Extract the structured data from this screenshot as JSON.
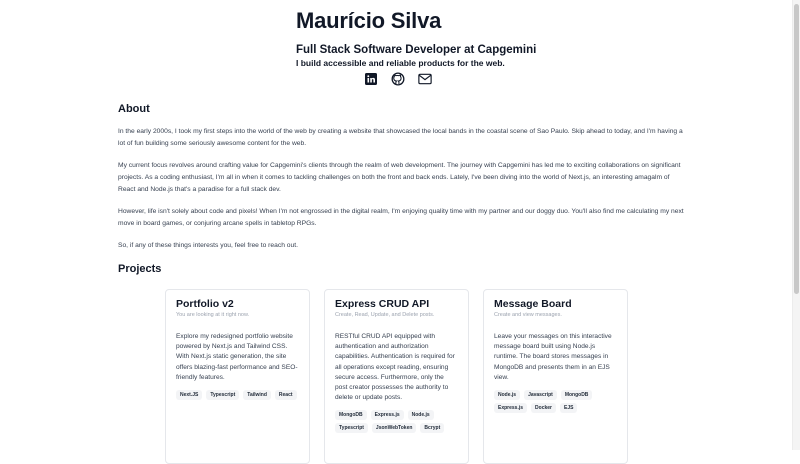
{
  "header": {
    "name": "Maurício Silva",
    "role": "Full Stack Software Developer at Capgemini",
    "tagline": "I build accessible and reliable products for the web.",
    "socials": [
      {
        "icon": "linkedin-icon"
      },
      {
        "icon": "github-icon"
      },
      {
        "icon": "mail-icon"
      }
    ]
  },
  "about": {
    "title": "About",
    "paragraphs": [
      "In the early 2000s, I took my first steps into the world of the web by creating a website that showcased the local bands in the coastal scene of Sao Paulo. Skip ahead to today, and I'm having a lot of fun building some seriously awesome content for the web.",
      "My current focus revolves around crafting value for Capgemini's clients through the realm of web development. The journey with Capgemini has led me to exciting collaborations on significant projects. As a coding enthusiast, I'm all in when it comes to tackling challenges on both the front and back ends. Lately, I've been diving into the world of Next.js, an interesting amagalm of React and Node.js that's a paradise for a full stack dev.",
      "However, life isn't solely about code and pixels! When I'm not engrossed in the digital realm, I'm enjoying quality time with my partner and our doggy duo. You'll also find me calculating my next move in board games, or conjuring arcane spells in tabletop RPGs.",
      "So, if any of these things interests you, feel free to reach out."
    ]
  },
  "projects": {
    "title": "Projects",
    "items": [
      {
        "title": "Portfolio v2",
        "subtitle": "You are looking at it right now.",
        "description": "Explore my redesigned portfolio website powered by Next.js and Tailwind CSS. With Next.js static generation, the site offers blazing-fast performance and SEO-friendly features.",
        "tags": [
          "Next.JS",
          "Typescript",
          "Tailwind",
          "React"
        ]
      },
      {
        "title": "Express CRUD API",
        "subtitle": "Create, Read, Update, and Delete posts.",
        "description": "RESTful CRUD API equipped with authentication and authorization capabilities. Authentication is required for all operations except reading, ensuring secure access. Furthermore, only the post creator possesses the authority to delete or update posts.",
        "tags": [
          "MongoDB",
          "Express.js",
          "Node.js",
          "Typescript",
          "JsonWebToken",
          "Bcrypt"
        ]
      },
      {
        "title": "Message Board",
        "subtitle": "Create and view messages.",
        "description": "Leave your messages on this interactive message board built using Node.js runtime. The board stores messages in MongoDB and presents them in an EJS view.",
        "tags": [
          "Node.js",
          "Javascript",
          "MongoDB",
          "Express.js",
          "Docker",
          "EJS"
        ]
      }
    ]
  }
}
